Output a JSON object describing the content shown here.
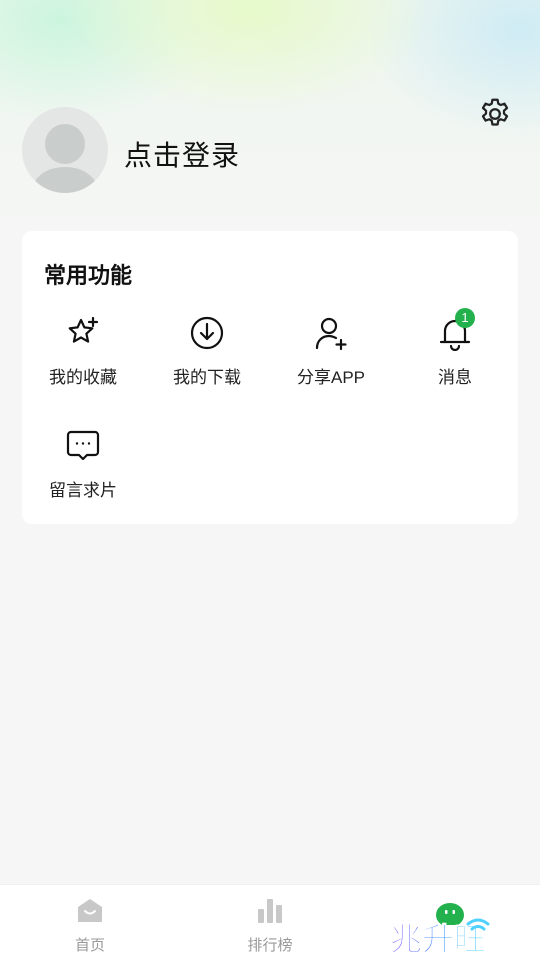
{
  "profile": {
    "login_text": "点击登录"
  },
  "functions": {
    "title": "常用功能",
    "items": [
      {
        "label": "我的收藏",
        "icon": "star-plus-icon"
      },
      {
        "label": "我的下载",
        "icon": "download-icon"
      },
      {
        "label": "分享APP",
        "icon": "add-user-icon"
      },
      {
        "label": "消息",
        "icon": "bell-icon",
        "badge": "1"
      },
      {
        "label": "留言求片",
        "icon": "chat-bubble-icon"
      }
    ]
  },
  "tabbar": {
    "items": [
      {
        "label": "首页",
        "icon": "home-icon"
      },
      {
        "label": "排行榜",
        "icon": "bar-chart-icon"
      },
      {
        "label": "",
        "icon": "mascot-icon"
      }
    ]
  },
  "watermark": {
    "text": "兆升旺"
  },
  "colors": {
    "accent": "#22b14c",
    "tab_inactive": "#c8c8c8"
  }
}
